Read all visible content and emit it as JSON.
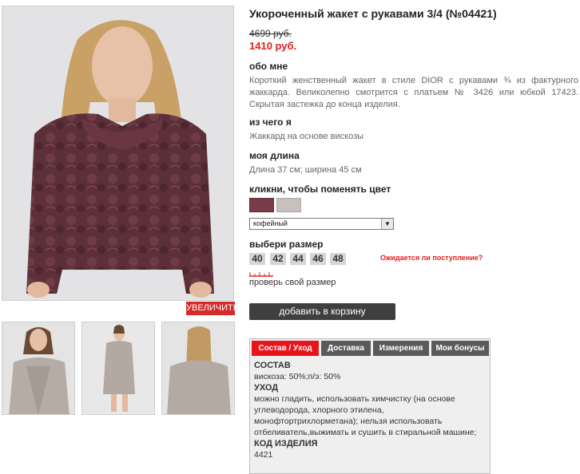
{
  "product": {
    "title": "Укороченный жакет с рукавами 3/4 (№04421)",
    "old_price": "4699 руб.",
    "new_price": "1410 руб."
  },
  "about": {
    "heading": "обо мне",
    "text": "Короткий женственный жакет в стиле DIOR с рукавами ¾ из фактурного жаккарда. Великолепно смотрится с платьем № 3426 или юбкой 17423. Скрытая застежка до конца изделия."
  },
  "material": {
    "heading": "из чего я",
    "text": "Жаккард на основе вискозы"
  },
  "length": {
    "heading": "моя длина",
    "text": "Длина 37 см; ширина 45 см"
  },
  "color": {
    "heading": "кликни, чтобы поменять цвет",
    "swatches": [
      {
        "name": "кофейный",
        "hex": "#7a3c48"
      },
      {
        "name": "серый",
        "hex": "#c9c0bd"
      }
    ],
    "selected": "кофейный"
  },
  "size": {
    "heading": "выбери размер",
    "options": [
      "40",
      "42",
      "44",
      "46",
      "48"
    ],
    "arrival_link": "Ожидается ли поступление?",
    "check_link": "проверь свой размер"
  },
  "cart_button": "добавить в корзину",
  "zoom_button": "УВЕЛИЧИТЬ",
  "tabs": [
    {
      "label": "Состав / Уход",
      "active": true
    },
    {
      "label": "Доставка",
      "active": false
    },
    {
      "label": "Измерения",
      "active": false
    },
    {
      "label": "Мои бонусы",
      "active": false
    }
  ],
  "tab_content": {
    "composition_h": "СОСТАВ",
    "composition": "вискоза: 50%;п/э: 50%",
    "care_h": "УХОД",
    "care": "можно гладить, использовать химчистку (на основе углеводорода, хлорного этилена, монофтортрихлорметана); нельзя использовать отбеливатель,выжимать и сушить в стиральной машине;",
    "code_h": "КОД ИЗДЕЛИЯ",
    "code": "4421"
  },
  "icons": {
    "dropdown": "chevron-down-icon",
    "ruler": "ruler-icon"
  }
}
